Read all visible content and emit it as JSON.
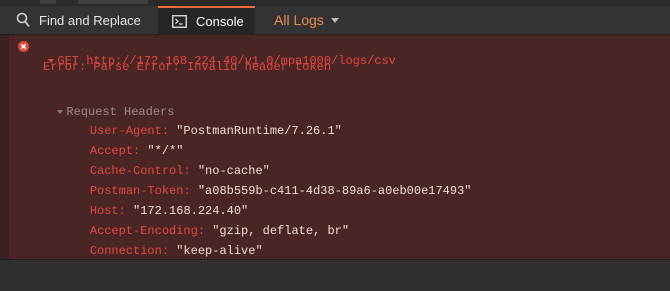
{
  "tabs": {
    "find_replace": "Find and Replace",
    "console": "Console",
    "logs_filter": "All Logs"
  },
  "log": {
    "request_line": "GET http://172.168.224.40/v1.0/mpa1000/logs/csv",
    "error_line": "Error: Parse Error: Invalid header token",
    "headers_title": "Request Headers",
    "headers": [
      {
        "key": "User-Agent: ",
        "value": "\"PostmanRuntime/7.26.1\""
      },
      {
        "key": "Accept: ",
        "value": "\"*/*\""
      },
      {
        "key": "Cache-Control: ",
        "value": "\"no-cache\""
      },
      {
        "key": "Postman-Token: ",
        "value": "\"a08b559b-c411-4d38-89a6-a0eb00e17493\""
      },
      {
        "key": "Host: ",
        "value": "\"172.168.224.40\""
      },
      {
        "key": "Accept-Encoding: ",
        "value": "\"gzip, deflate, br\""
      },
      {
        "key": "Connection: ",
        "value": "\"keep-alive\""
      }
    ]
  },
  "colors": {
    "accent": "#f26b3a",
    "error_red": "#e0473f",
    "error_bg": "#4a2525",
    "tab_bg": "#333333"
  },
  "icons": {
    "find": "search-icon",
    "console": "console-icon",
    "error": "error-icon",
    "dropdown": "chevron-down-icon"
  }
}
